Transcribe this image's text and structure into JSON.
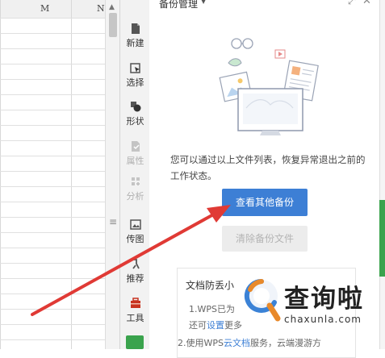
{
  "sheet": {
    "columns": [
      "M",
      "N"
    ]
  },
  "toolbar": {
    "items": [
      {
        "label": "新建",
        "icon": "new-file-icon",
        "disabled": false
      },
      {
        "label": "选择",
        "icon": "select-cursor-icon",
        "disabled": false
      },
      {
        "label": "形状",
        "icon": "shapes-icon",
        "disabled": false
      },
      {
        "label": "属性",
        "icon": "properties-icon",
        "disabled": true
      },
      {
        "label": "分析",
        "icon": "analysis-icon",
        "disabled": true
      },
      {
        "label": "传图",
        "icon": "upload-image-icon",
        "disabled": false
      },
      {
        "label": "推荐",
        "icon": "recommend-icon",
        "disabled": false
      },
      {
        "label": "工具",
        "icon": "toolbox-icon",
        "disabled": false
      }
    ]
  },
  "panel": {
    "title": "备份管理",
    "description": "您可以通过以上文件列表，恢复异常退出之前的工作状态。",
    "view_button": "查看其他备份",
    "clear_button": "清除备份文件",
    "tips": {
      "title": "文档防丢小",
      "line1_a": "1.WPS已为",
      "line2_a": "还可",
      "line2_link": "设置",
      "line2_b": "更多",
      "line3_a": "2.使用WPS",
      "line3_link": "云文档",
      "line3_b": "服务，云端漫游方"
    }
  },
  "watermark": {
    "text": "查询啦",
    "domain": "chaxunla.com"
  },
  "colors": {
    "primary_button": "#3d7fd5",
    "arrow": "#e03a35",
    "accent_green": "#3aa34d"
  }
}
